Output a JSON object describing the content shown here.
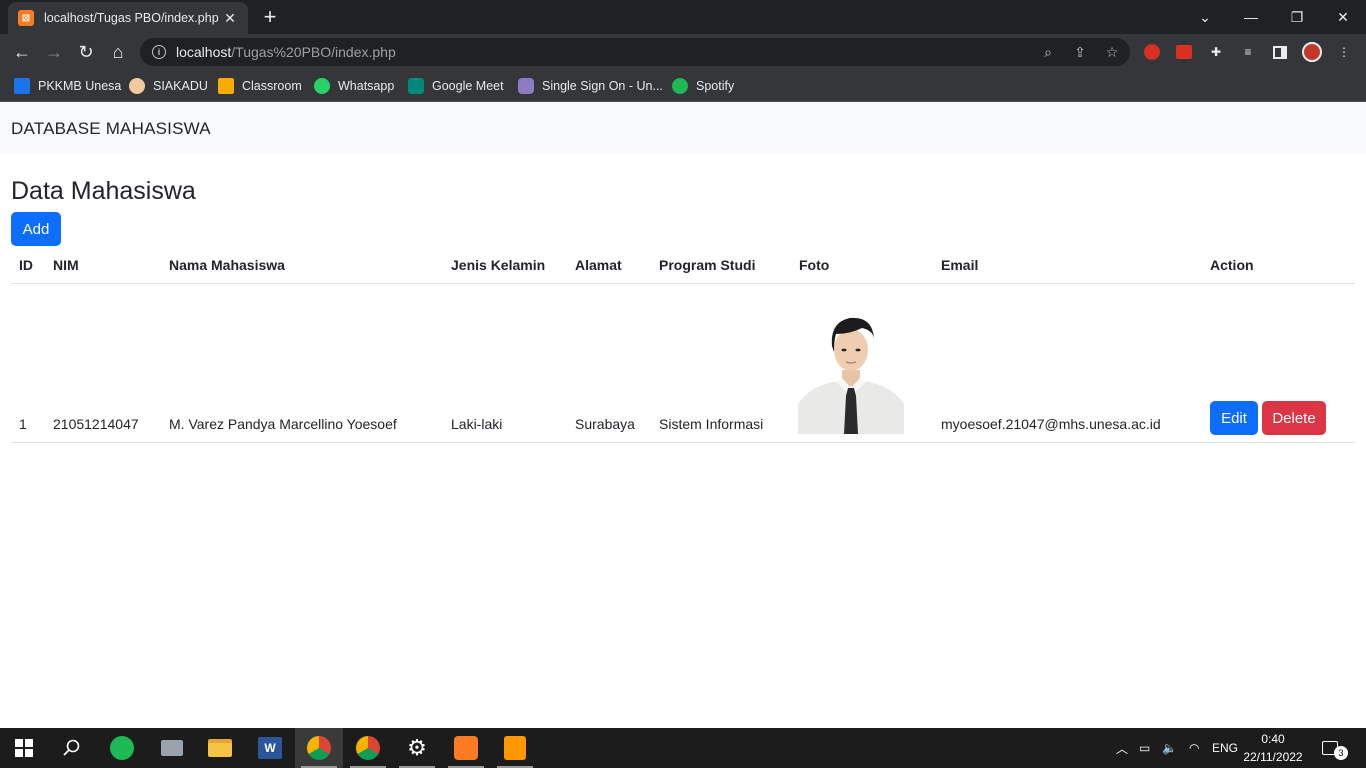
{
  "browser": {
    "tab_title": "localhost/Tugas PBO/index.php",
    "url_host": "localhost",
    "url_path": "/Tugas%20PBO/index.php",
    "bookmarks": [
      {
        "label": "PKKMB Unesa",
        "color": "#1a73e8"
      },
      {
        "label": "SIAKADU",
        "color": "#f0c9a0"
      },
      {
        "label": "Classroom",
        "color": "#f9ab00"
      },
      {
        "label": "Whatsapp",
        "color": "#25d366"
      },
      {
        "label": "Google Meet",
        "color": "#00897b"
      },
      {
        "label": "Single Sign On - Un...",
        "color": "#8e7cc3"
      },
      {
        "label": "Spotify",
        "color": "#1db954"
      }
    ]
  },
  "page": {
    "brand": "DATABASE MAHASISWA",
    "heading": "Data Mahasiswa",
    "add_label": "Add",
    "columns": [
      "ID",
      "NIM",
      "Nama Mahasiswa",
      "Jenis Kelamin",
      "Alamat",
      "Program Studi",
      "Foto",
      "Email",
      "Action"
    ],
    "rows": [
      {
        "id": "1",
        "nim": "21051214047",
        "nama": "M. Varez Pandya Marcellino Yoesoef",
        "jenis_kelamin": "Laki-laki",
        "alamat": "Surabaya",
        "program_studi": "Sistem Informasi",
        "email": "myoesoef.21047@mhs.unesa.ac.id",
        "edit_label": "Edit",
        "delete_label": "Delete"
      }
    ]
  },
  "taskbar": {
    "language": "ENG",
    "time": "0:40",
    "date": "22/11/2022",
    "notification_count": "3"
  }
}
